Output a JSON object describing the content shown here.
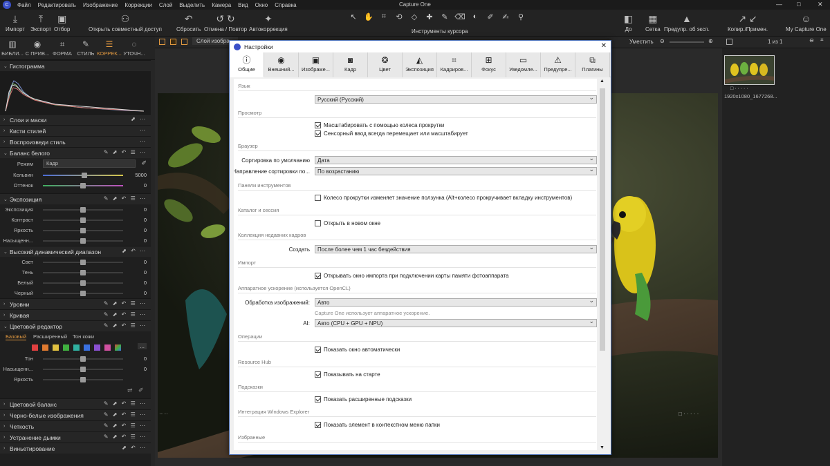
{
  "app": {
    "title": "Capture One"
  },
  "menu": [
    "Файл",
    "Редактировать",
    "Изображение",
    "Коррекции",
    "Слой",
    "Выделить",
    "Камера",
    "Вид",
    "Окно",
    "Справка"
  ],
  "window_controls": {
    "minimize": "—",
    "maximize": "□",
    "close": "✕"
  },
  "toolbar": {
    "import": "Импорт",
    "export": "Экспорт",
    "select": "Отбор",
    "shared_access": "Открыть совместный доступ",
    "reset": "Сбросить",
    "undo_redo": "Отмена / Повтор",
    "autocorrect": "Автокоррекция",
    "cursor_tools": "Инструменты курсора",
    "before": "До",
    "grid": "Сетка",
    "exposure_warning": "Предупр. об эксп.",
    "copy_apply": "Копир./Примен.",
    "my_capture_one": "My Capture One"
  },
  "left_tabs": [
    {
      "label": "БИБЛИ...",
      "icon": "library-icon"
    },
    {
      "label": "С ПРИВ...",
      "icon": "camera-icon"
    },
    {
      "label": "ФОРМА",
      "icon": "crop-icon"
    },
    {
      "label": "СТИЛЬ",
      "icon": "brush-icon"
    },
    {
      "label": "КОРРЕК...",
      "icon": "sliders-icon",
      "active": true
    },
    {
      "label": "УТОЧН...",
      "icon": "refine-icon"
    }
  ],
  "left_panel": {
    "histogram": "Гистограмма",
    "layers": "Слои и маски",
    "style_brushes": "Кисти стилей",
    "reproduce_style": "Воспроизведи стиль",
    "white_balance": {
      "title": "Баланс белого",
      "mode_label": "Режим",
      "mode_value": "Кадр",
      "kelvin_label": "Кельвин",
      "kelvin_value": "5000",
      "kelvin_level": 0.52,
      "tint_label": "Оттенок",
      "tint_value": "0",
      "tint_level": 0.5
    },
    "exposure": {
      "title": "Экспозиция",
      "rows": [
        {
          "label": "Экспозиция",
          "value": "0",
          "level": 0.5
        },
        {
          "label": "Контраст",
          "value": "0",
          "level": 0.5
        },
        {
          "label": "Яркость",
          "value": "0",
          "level": 0.5
        },
        {
          "label": "Насыщенн...",
          "value": "0",
          "level": 0.5
        }
      ]
    },
    "hdr": {
      "title": "Высокий динамический диапазон",
      "rows": [
        {
          "label": "Свет",
          "value": "0",
          "level": 0.5
        },
        {
          "label": "Тень",
          "value": "0",
          "level": 0.5
        },
        {
          "label": "Белый",
          "value": "0",
          "level": 0.5
        },
        {
          "label": "Черный",
          "value": "0",
          "level": 0.5
        }
      ]
    },
    "levels": "Уровни",
    "curve": "Кривая",
    "color_editor": {
      "title": "Цветовой редактор",
      "tabs": [
        "Базовый",
        "Расширенный",
        "Тон кожи"
      ],
      "swatches": [
        "#e04040",
        "#e07a30",
        "#e0c040",
        "#40b040",
        "#30b0a0",
        "#3a70e0",
        "#8a50d0",
        "#d050a0"
      ],
      "more": "...",
      "rows": [
        {
          "label": "Тон",
          "value": "0",
          "level": 0.5
        },
        {
          "label": "Насыщенн...",
          "value": "0",
          "level": 0.5
        },
        {
          "label": "Яркость",
          "value": "",
          "level": 0.5
        }
      ]
    },
    "color_balance": "Цветовой баланс",
    "bw": "Черно-белые изображения",
    "sharpness": "Четкость",
    "dehaze": "Устранение дымки",
    "vignette": "Виньетирование"
  },
  "viewer": {
    "layer_label": "Слой изобра...",
    "fit_label": "Уместить"
  },
  "browser": {
    "counter": "1 из 1",
    "filename": "1920x1080_1677268..."
  },
  "dialog": {
    "title": "Настройки",
    "close": "✕",
    "tabs": [
      {
        "label": "Общие",
        "icon": "info-icon",
        "active": true
      },
      {
        "label": "Внешний...",
        "icon": "eye-icon"
      },
      {
        "label": "Изображе...",
        "icon": "image-icon"
      },
      {
        "label": "Кадр",
        "icon": "camera-icon"
      },
      {
        "label": "Цвет",
        "icon": "color-circles-icon"
      },
      {
        "label": "Экспозиция",
        "icon": "exposure-icon"
      },
      {
        "label": "Кадриров...",
        "icon": "crop-icon"
      },
      {
        "label": "Фокус",
        "icon": "focus-icon"
      },
      {
        "label": "Уведомле...",
        "icon": "notification-icon"
      },
      {
        "label": "Предупре...",
        "icon": "warning-icon"
      },
      {
        "label": "Плагины",
        "icon": "plugin-icon"
      }
    ],
    "groups": {
      "language": "Язык",
      "language_value": "Русский (Русский)",
      "view": "Просмотр",
      "view_cb1": "Масштабировать с помощью колеса прокрутки",
      "view_cb2": "Сенсорный ввод всегда перемещает или масштабирует",
      "browser": "Браузер",
      "sort_label": "Сортировка по умолчанию",
      "sort_value": "Дата",
      "sort_dir_label": "Направление сортировки по...",
      "sort_dir_value": "По возрастанию",
      "toolbars": "Панели инструментов",
      "toolbars_cb": "Колесо прокрутки изменяет значение ползунка (Alt+колесо прокручивает вкладку инструментов)",
      "catalog": "Каталог и сессия",
      "catalog_cb": "Открыть в новом окне",
      "recent": "Коллекция недавних кадров",
      "create_label": "Создать",
      "create_value": "После более чем 1 час бездействия",
      "import": "Импорт",
      "import_cb": "Открывать окно импорта при подключении карты памяти фотоаппарата",
      "hw": "Аппаратное ускорение (используется OpenCL)",
      "hw_label": "Обработка изображений:",
      "hw_value": "Авто",
      "hw_hint": "Capture One использует аппаратное ускорение.",
      "ai_label": "AI:",
      "ai_value": "Авто (CPU + GPU + NPU)",
      "ops": "Операции",
      "ops_cb": "Показать окно автоматически",
      "hub": "Resource Hub",
      "hub_cb": "Показывать на старте",
      "tips": "Подсказки",
      "tips_cb": "Показать расширенные подсказки",
      "explorer": "Интеграция Windows Explorer",
      "explorer_cb": "Показать элемент в контекстном меню папки",
      "favorites": "Избранные"
    }
  }
}
